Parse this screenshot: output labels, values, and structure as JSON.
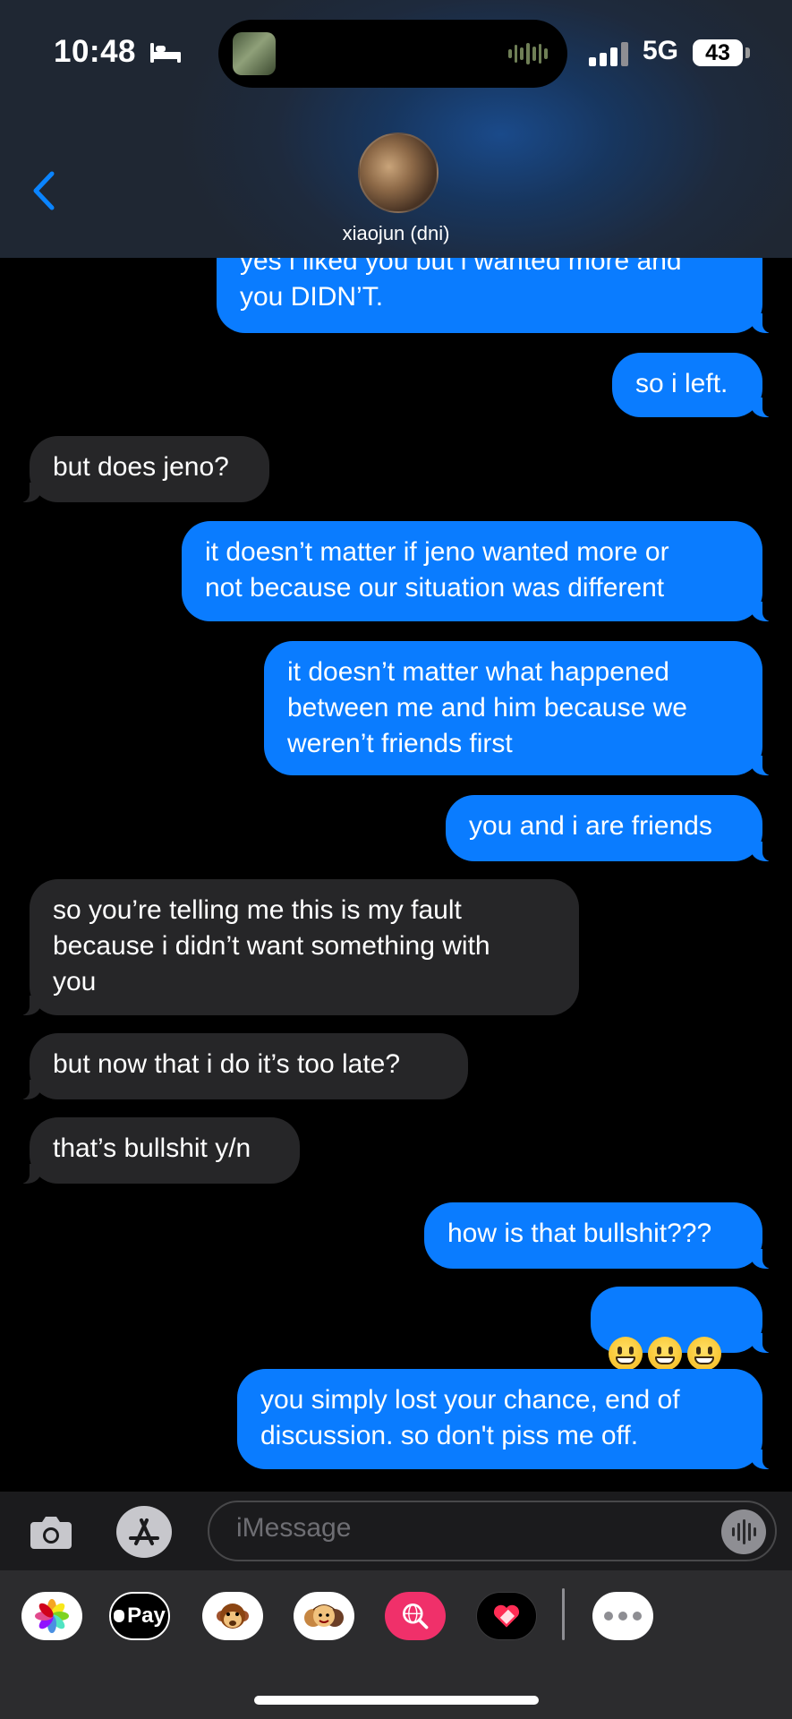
{
  "status": {
    "time": "10:48",
    "network": "5G",
    "battery": "43"
  },
  "contact": {
    "name": "xiaojun (dni)"
  },
  "messages": [
    {
      "dir": "out",
      "text": "yes i liked you but i wanted more and\nyou DIDN’T."
    },
    {
      "dir": "out",
      "text": "so i left."
    },
    {
      "dir": "in",
      "text": "but does jeno?"
    },
    {
      "dir": "out",
      "text": "it doesn’t matter if jeno wanted more or\nnot because our situation was different"
    },
    {
      "dir": "out",
      "text": "it doesn’t matter what happened\nbetween me and him because we\nweren’t friends first"
    },
    {
      "dir": "out",
      "text": "you and i are friends"
    },
    {
      "dir": "in",
      "text": "so you’re telling me this is my fault\nbecause i didn’t want something with\nyou"
    },
    {
      "dir": "in",
      "text": "but now that i do it’s too late?"
    },
    {
      "dir": "in",
      "text": "that’s bullshit y/n"
    },
    {
      "dir": "out",
      "text": "how is that bullshit???"
    },
    {
      "dir": "out",
      "text": "😀😀😀",
      "emoji": true
    },
    {
      "dir": "out",
      "text": "you simply lost your chance, end of\ndiscussion. so don't piss me off."
    }
  ],
  "composer": {
    "placeholder": "iMessage"
  },
  "apps": [
    {
      "name": "photos-app-icon"
    },
    {
      "name": "apple-pay-app-icon",
      "label": "Pay"
    },
    {
      "name": "monkey-memoji-app-icon"
    },
    {
      "name": "memoji-stickers-app-icon"
    },
    {
      "name": "image-search-app-icon"
    },
    {
      "name": "digital-touch-app-icon"
    },
    {
      "name": "more-apps-icon"
    }
  ],
  "colors": {
    "outgoing": "#0a7cff",
    "incoming": "#262628",
    "accent": "#0a84ff"
  }
}
